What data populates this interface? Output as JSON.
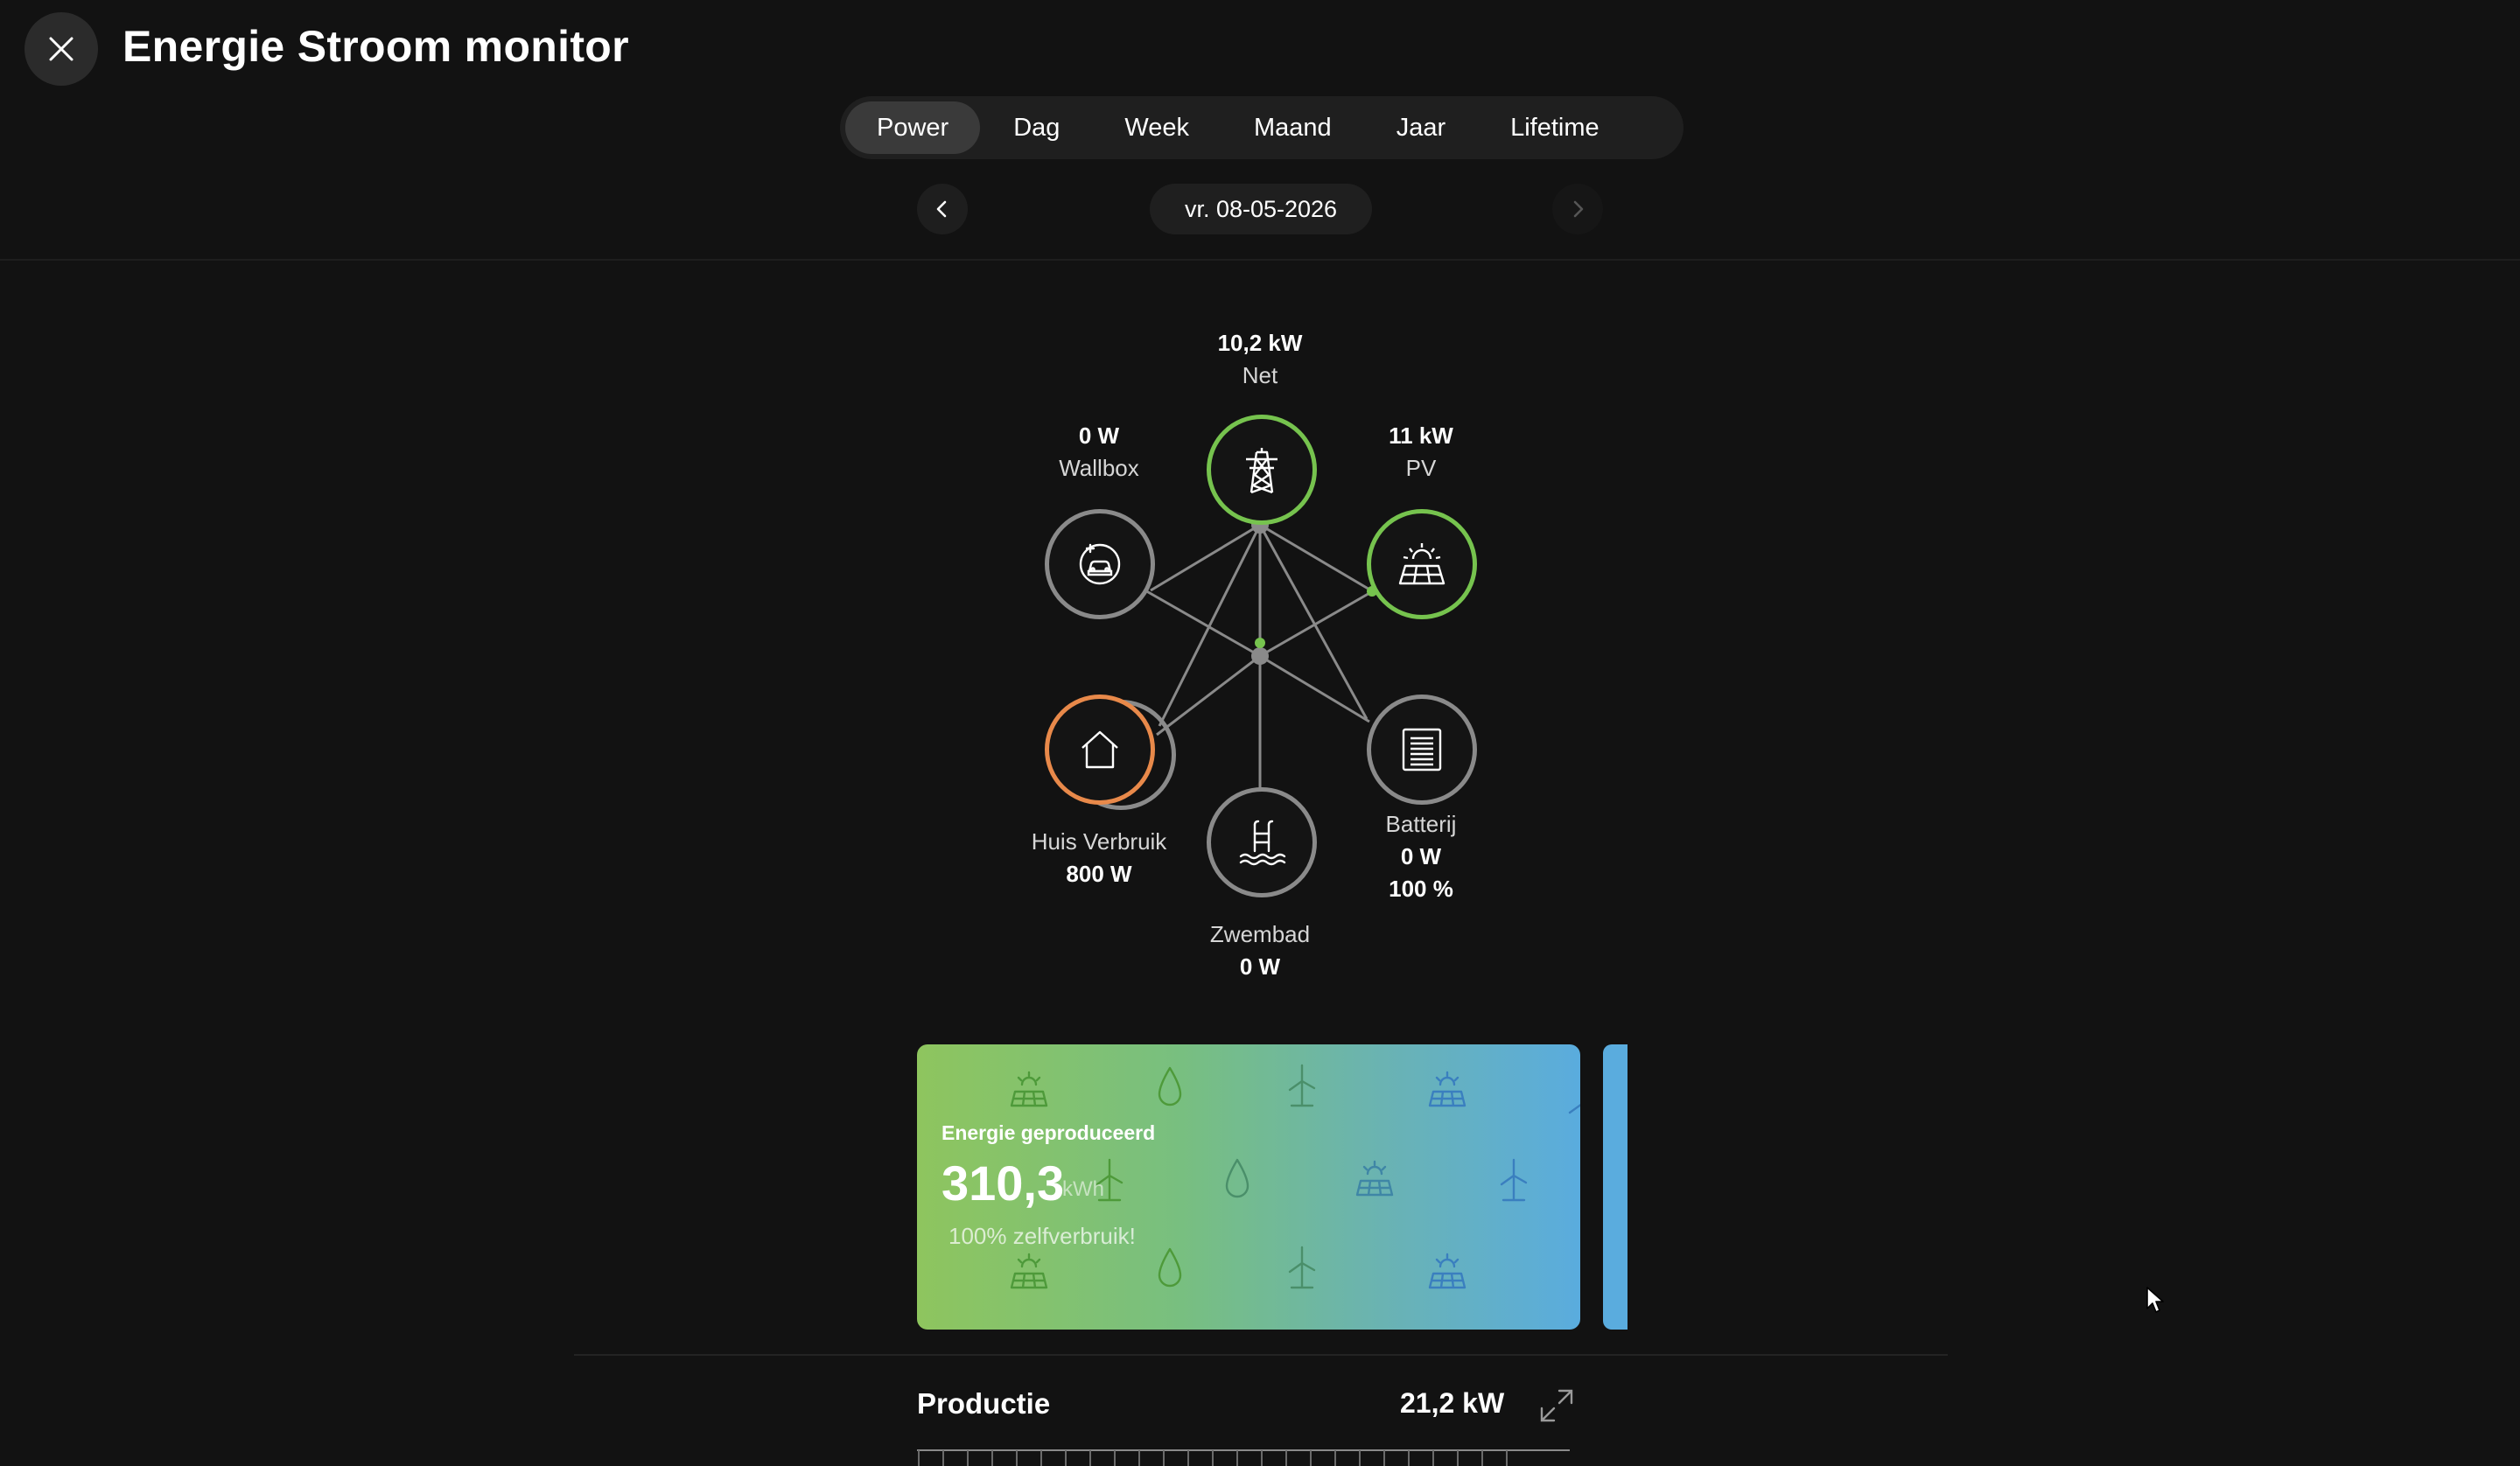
{
  "header": {
    "title": "Energie Stroom monitor",
    "close_icon": "close-icon"
  },
  "tabs": [
    {
      "label": "Power",
      "active": true
    },
    {
      "label": "Dag",
      "active": false
    },
    {
      "label": "Week",
      "active": false
    },
    {
      "label": "Maand",
      "active": false
    },
    {
      "label": "Jaar",
      "active": false
    },
    {
      "label": "Lifetime",
      "active": false
    }
  ],
  "date_nav": {
    "date": "vr. 08-05-2026",
    "prev_icon": "chevron-left-icon",
    "next_icon": "chevron-right-icon"
  },
  "flow": {
    "net": {
      "value": "10,2 kW",
      "name": "Net",
      "icon": "power-pylon-icon",
      "color": "#76c34e"
    },
    "wallbox": {
      "value": "0 W",
      "name": "Wallbox",
      "icon": "ev-car-icon"
    },
    "pv": {
      "value": "11 kW",
      "name": "PV",
      "icon": "solar-panel-icon",
      "color": "#76c34e"
    },
    "huis": {
      "name": "Huis Verbruik",
      "value": "800 W",
      "icon": "house-icon",
      "color": "#e8894a"
    },
    "batterij": {
      "name": "Batterij",
      "value": "0 W",
      "percent": "100 %",
      "icon": "battery-icon"
    },
    "zwembad": {
      "name": "Zwembad",
      "value": "0 W",
      "icon": "pool-ladder-icon"
    }
  },
  "card": {
    "title": "Energie geproduceerd",
    "value": "310,3",
    "unit": "kWh",
    "subtitle": "100% zelfverbruik!"
  },
  "production": {
    "label": "Productie",
    "value": "21,2 kW",
    "expand_icon": "expand-icon"
  },
  "colors": {
    "background": "#121212",
    "green": "#76c34e",
    "orange": "#e8894a",
    "blue": "#5aacde"
  }
}
